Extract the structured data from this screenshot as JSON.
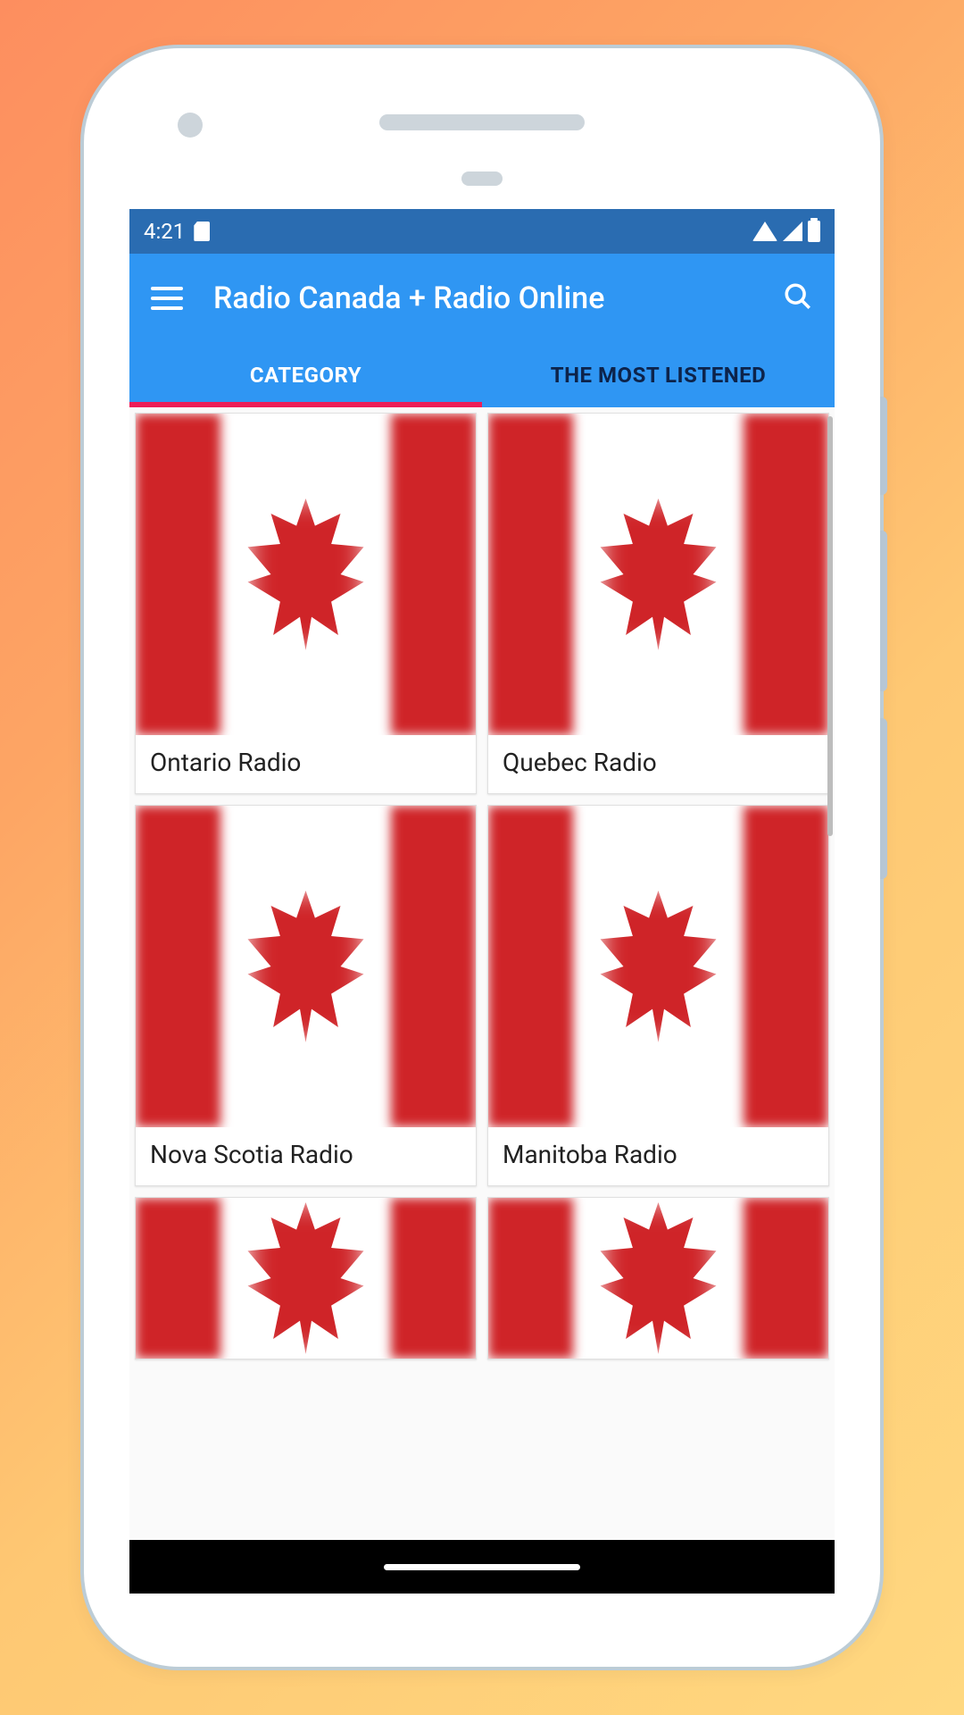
{
  "status": {
    "time": "4:21"
  },
  "header": {
    "title": "Radio Canada + Radio Online"
  },
  "tabs": [
    {
      "label": "CATEGORY",
      "active": true
    },
    {
      "label": "THE MOST LISTENED",
      "active": false
    }
  ],
  "categories": [
    {
      "label": "Ontario Radio"
    },
    {
      "label": "Quebec Radio"
    },
    {
      "label": "Nova Scotia Radio"
    },
    {
      "label": "Manitoba Radio"
    },
    {
      "label": ""
    },
    {
      "label": ""
    }
  ]
}
